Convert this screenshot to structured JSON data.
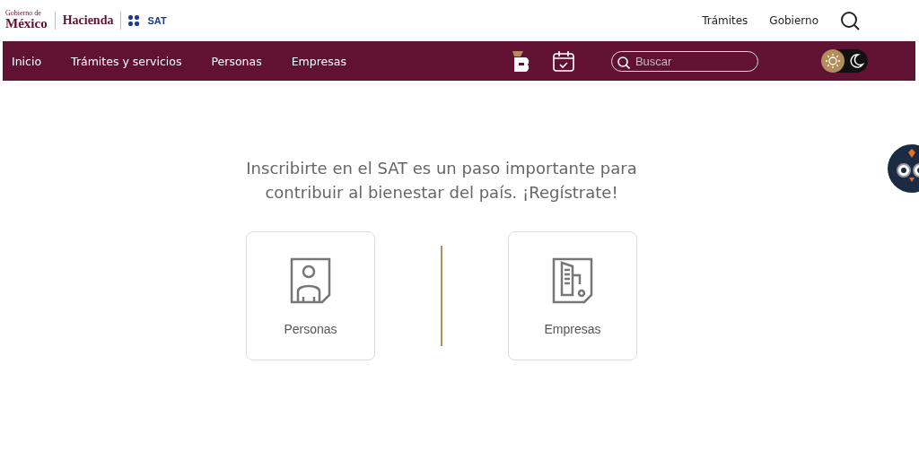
{
  "header": {
    "logo": {
      "line_1": "Gobierno de",
      "line_2": "México",
      "hacienda": "Hacienda",
      "sat": "SAT"
    },
    "links": [
      "Trámites",
      "Gobierno"
    ]
  },
  "nav": {
    "items": [
      {
        "label": "Inicio"
      },
      {
        "label": "Trámites y servicios"
      },
      {
        "label": "Personas"
      },
      {
        "label": "Empresas"
      }
    ],
    "search": {
      "placeholder": "Buscar"
    },
    "theme": [
      {
        "kind": "light",
        "selected": true
      },
      {
        "kind": "dark",
        "selected": false
      }
    ]
  },
  "main": {
    "heading": "Inscribirte en el SAT es un paso importante para contribuir al bienestar del país. ¡Regístrate!",
    "cards": [
      {
        "kind": "person",
        "label": "Personas"
      },
      {
        "kind": "company",
        "label": "Empresas"
      }
    ]
  }
}
